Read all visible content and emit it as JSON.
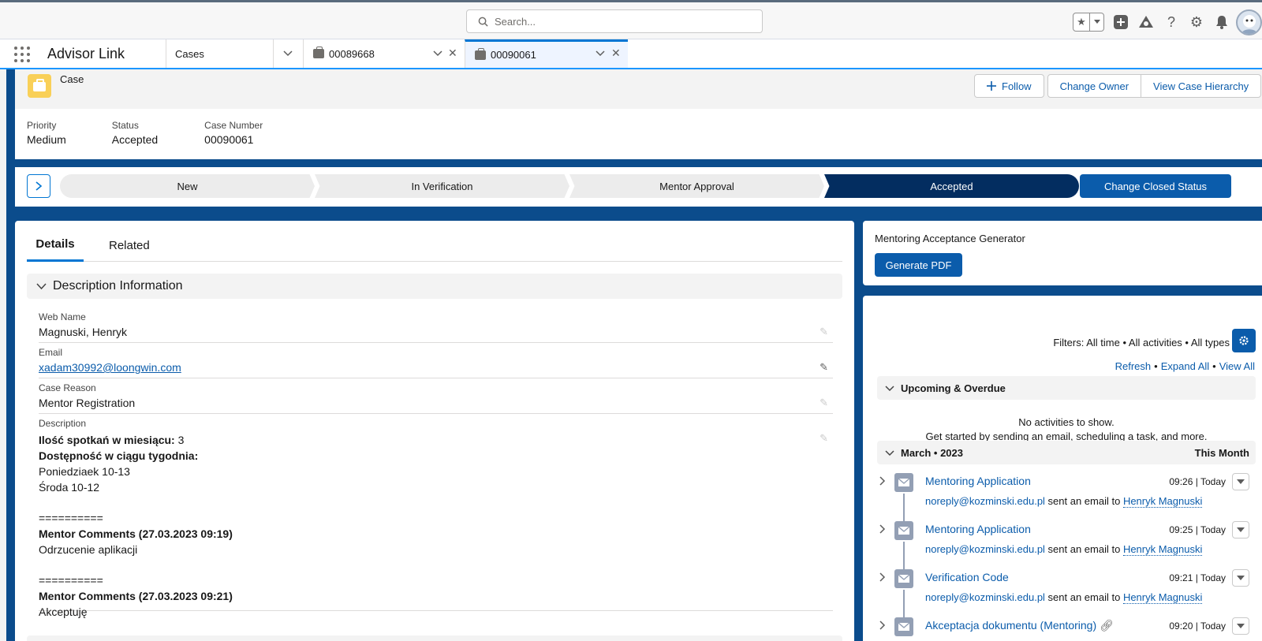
{
  "global": {
    "search_placeholder": "Search..."
  },
  "nav": {
    "app_name": "Advisor Link",
    "object_tab": "Cases",
    "workspace_tabs": [
      {
        "label": "00089668",
        "active": false
      },
      {
        "label": "00090061",
        "active": true
      }
    ]
  },
  "header": {
    "object_label": "Case",
    "buttons": {
      "follow": "Follow",
      "change_owner": "Change Owner",
      "view_hierarchy": "View Case Hierarchy"
    },
    "fields": [
      {
        "label": "Priority",
        "value": "Medium"
      },
      {
        "label": "Status",
        "value": "Accepted"
      },
      {
        "label": "Case Number",
        "value": "00090061"
      }
    ]
  },
  "path": {
    "steps": [
      "New",
      "In Verification",
      "Mentor Approval",
      "Accepted"
    ],
    "current": "Accepted",
    "action_button": "Change Closed Status"
  },
  "details": {
    "tabs": [
      "Details",
      "Related"
    ],
    "section_title": "Description Information",
    "web_name_label": "Web Name",
    "web_name": "Magnuski, Henryk",
    "email_label": "Email",
    "email": "xadam30992@loongwin.com",
    "case_reason_label": "Case Reason",
    "case_reason": "Mentor Registration",
    "description_label": "Description",
    "description": {
      "l1_bold": "Ilość spotkań w miesiącu:",
      "l1_val": " 3",
      "l2_bold": "Dostępność w ciągu tygodnia:",
      "l3": "Poniedziaek 10-13",
      "l4": "Środa 10-12",
      "sep1": "==========",
      "c1_title": "Mentor Comments (27.03.2023 09:19)",
      "c1_text": "Odrzucenie aplikacji",
      "sep2": "==========",
      "c2_title": "Mentor Comments (27.03.2023 09:21)",
      "c2_text": "Akceptuję"
    }
  },
  "generator": {
    "title": "Mentoring Acceptance Generator",
    "button": "Generate PDF"
  },
  "activity": {
    "filters": "Filters: All time • All activities • All types",
    "refresh": "Refresh",
    "expand_all": "Expand All",
    "view_all": "View All",
    "upcoming_title": "Upcoming & Overdue",
    "no_activities": "No activities to show.",
    "get_started": "Get started by sending an email, scheduling a task, and more.",
    "month_title": "March • 2023",
    "month_right": "This Month",
    "items": [
      {
        "subject": "Mentoring Application",
        "time": "09:26 | Today",
        "from": "noreply@kozminski.edu.pl",
        "verb": " sent an email to ",
        "to": "Henryk Magnuski"
      },
      {
        "subject": "Mentoring Application",
        "time": "09:25 | Today",
        "from": "noreply@kozminski.edu.pl",
        "verb": " sent an email to ",
        "to": "Henryk Magnuski"
      },
      {
        "subject": "Verification Code",
        "time": "09:21 | Today",
        "from": "noreply@kozminski.edu.pl",
        "verb": " sent an email to ",
        "to": "Henryk Magnuski"
      },
      {
        "subject": "Akceptacja dokumentu (Mentoring)",
        "time": "09:20 | Today"
      }
    ]
  },
  "colors": {
    "brand_blue": "#0b5cab",
    "page_bg": "#0b4c8c",
    "path_current": "#032d60",
    "case_icon": "#f9d058"
  }
}
